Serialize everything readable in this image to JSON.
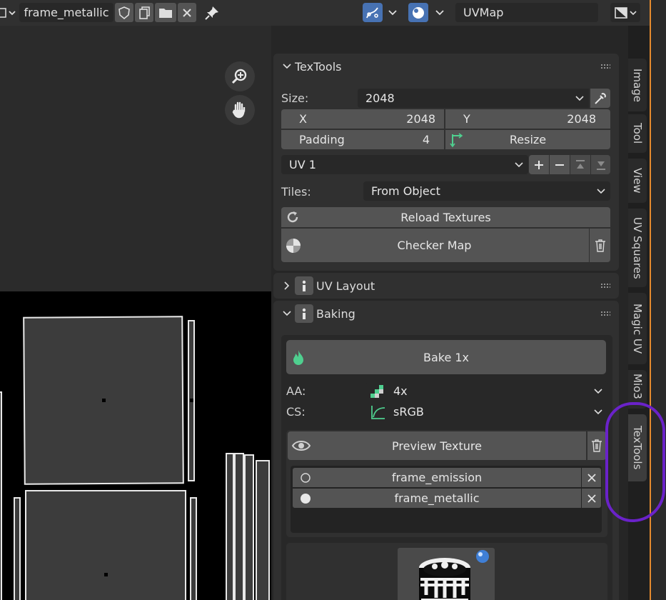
{
  "header": {
    "image_name": "frame_metallic",
    "uv_map": "UVMap"
  },
  "sidebar": {
    "textools_panel": {
      "title": "TexTools",
      "size_label": "Size:",
      "size_value": "2048",
      "x_label": "X",
      "x_value": "2048",
      "y_label": "Y",
      "y_value": "2048",
      "padding_label": "Padding",
      "padding_value": "4",
      "resize_label": "Resize",
      "uv_channel": "UV 1",
      "tiles_label": "Tiles:",
      "tiles_value": "From Object",
      "reload_label": "Reload Textures",
      "checker_label": "Checker Map"
    },
    "uv_layout_panel": {
      "title": "UV Layout"
    },
    "baking_panel": {
      "title": "Baking",
      "bake_label": "Bake 1x",
      "aa_label": "AA:",
      "aa_value": "4x",
      "cs_label": "CS:",
      "cs_value": "sRGB",
      "preview_label": "Preview Texture",
      "textures": [
        {
          "name": "frame_emission",
          "selected": false
        },
        {
          "name": "frame_metallic",
          "selected": true
        }
      ]
    }
  },
  "tabs": [
    "Image",
    "Tool",
    "View",
    "UV Squares",
    "Magic UV",
    "Mio3",
    "TexTools"
  ],
  "active_tab": "TexTools",
  "colors": {
    "accent_blue": "#4772b3",
    "bake_icon_green": "#4fcf8f",
    "editor_border_orange": "#e58b2e",
    "annotation_purple": "#6a22c9"
  }
}
